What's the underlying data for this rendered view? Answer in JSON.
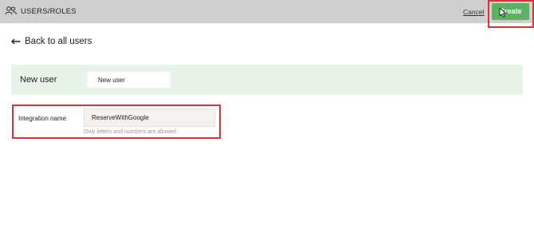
{
  "header": {
    "section_title": "USERS/ROLES",
    "cancel_label": "Cancel",
    "create_label": "Create",
    "icons": {
      "section": "users-icon",
      "cursor": "mouse-pointer-icon"
    },
    "colors": {
      "bar": "#cfcfcf",
      "create_button": "#5cb263",
      "annotation": "#e03030"
    }
  },
  "navigation": {
    "back_label": "Back to all users",
    "back_icon": "arrow-left-icon"
  },
  "new_user_panel": {
    "label": "New user",
    "name_value": "New user",
    "background": "#e8f4e8"
  },
  "integration": {
    "label": "Integration name",
    "value": "ReserveWithGoogle",
    "hint": "Only letters and numbers are allowed"
  }
}
